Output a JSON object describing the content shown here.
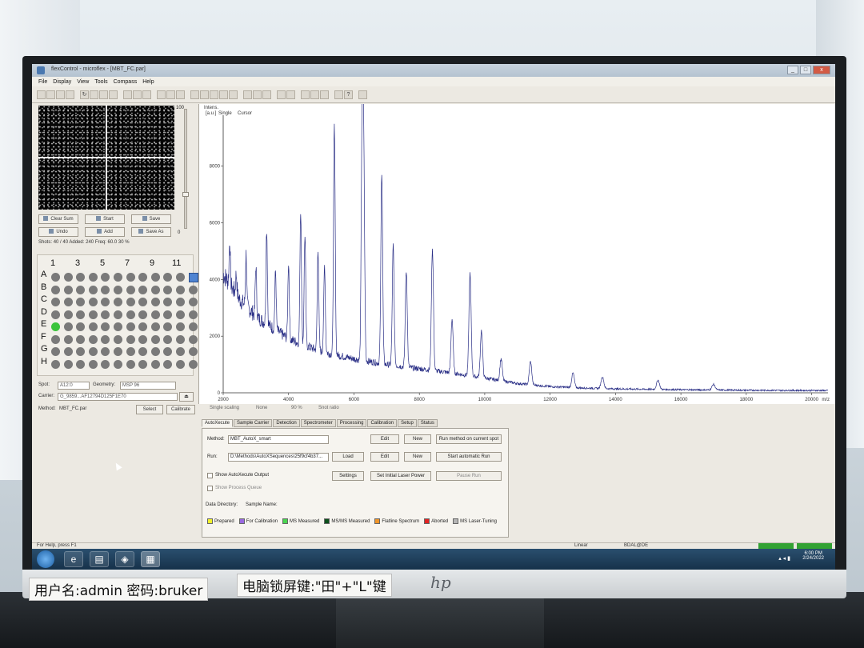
{
  "window": {
    "title": "flexControl - microflex - [MBT_FC.par]"
  },
  "menu": [
    "File",
    "Display",
    "View",
    "Tools",
    "Compass",
    "Help"
  ],
  "camera_panel": {
    "slider_max": "100",
    "slider_min": "0",
    "buttons": {
      "clear_sum": "Clear Sum",
      "start": "Start",
      "save": "Save",
      "undo": "Undo",
      "add": "Add",
      "save_as": "Save As"
    },
    "shots_label": "Shots:",
    "shots_value": "40",
    "shots_total": "40",
    "added_label": "Added:",
    "added_value": "240",
    "freq_label": "Freq:",
    "freq_value": "60.0",
    "percent": "30 %"
  },
  "plate": {
    "columns": [
      "1",
      "3",
      "5",
      "7",
      "9",
      "11"
    ],
    "rows": [
      "A",
      "B",
      "C",
      "D",
      "E",
      "F",
      "G",
      "H"
    ],
    "active_well": "E1"
  },
  "spot_info": {
    "spot_label": "Spot:",
    "spot_value": "A12:0",
    "geometry_label": "Geometry:",
    "geometry_value": "MSP 96",
    "carrier_label": "Carrier:",
    "carrier_value": "G_9859...AF12794D125F1E70",
    "method_label": "Method:",
    "method_value": "MBT_FC.par",
    "select_btn": "Select",
    "calibrate_btn": "Calibrate"
  },
  "spectrum": {
    "y_label": "Intens.",
    "y_unit": "[a.u.]",
    "header_single": "Single",
    "header_cursor": "Cursor",
    "x_unit": "m/z",
    "x_ticks": [
      "2000",
      "4000",
      "6000",
      "8000",
      "10000",
      "12000",
      "14000",
      "16000",
      "18000",
      "20000"
    ],
    "y_ticks": [
      "0",
      "2000",
      "4000",
      "6000",
      "8000"
    ],
    "scale_options": [
      "Single scaling",
      "None",
      "90 %",
      "Snot ratio"
    ]
  },
  "tabs": [
    "AutoXecute",
    "Sample Carrier",
    "Detection",
    "Spectrometer",
    "Processing",
    "Calibration",
    "Setup",
    "Status"
  ],
  "autoxecute": {
    "method_label": "Method:",
    "method_value": "MBT_AutoX_smart",
    "run_label": "Run:",
    "run_value": "D:\\Methods\\AutoXSequences\\25f9cf4b37...",
    "edit1": "Edit",
    "new1": "New",
    "run_on_spot": "Run method on current spot",
    "load": "Load",
    "edit2": "Edit",
    "new2": "New",
    "start_auto": "Start automatic Run",
    "settings": "Settings",
    "set_laser": "Set Initial Laser Power",
    "pause": "Pause Run",
    "show_output": "Show AutoXecute Output",
    "show_queue": "Show Process Queue",
    "data_dir": "Data Directory:",
    "sample_name": "Sample Name:",
    "legend": [
      {
        "label": "Prepared",
        "color": "#f2f22a"
      },
      {
        "label": "For Calibration",
        "color": "#9a6ae0"
      },
      {
        "label": "MS Measured",
        "color": "#49d64f"
      },
      {
        "label": "MS/MS Measured",
        "color": "#0c4f1b"
      },
      {
        "label": "Flatline Spectrum",
        "color": "#f0952a"
      },
      {
        "label": "Aborted",
        "color": "#e32222"
      },
      {
        "label": "MS Laser-Tuning",
        "color": "#b5b5b5"
      }
    ]
  },
  "status_bar": {
    "help": "For Help, press F1",
    "mode": "Linear",
    "tag": "BDAL@DE"
  },
  "taskbar": {
    "time": "6:00 PM",
    "date": "2/24/2022"
  },
  "stickers": {
    "user": "用户名:admin  密码:bruker",
    "lock": "电脑锁屏键:\"田\"+\"L\"键"
  },
  "brand": "hp",
  "chart_data": {
    "type": "line",
    "x_range": [
      2000,
      20500
    ],
    "y_range": [
      0,
      9800
    ],
    "xlabel": "m/z",
    "ylabel": "Intens. [a.u.]",
    "series": [
      {
        "name": "Single",
        "baseline": [
          [
            2000,
            4200
          ],
          [
            2500,
            3300
          ],
          [
            3000,
            2700
          ],
          [
            3500,
            2300
          ],
          [
            4000,
            1900
          ],
          [
            5000,
            1450
          ],
          [
            6000,
            1200
          ],
          [
            7000,
            1000
          ],
          [
            8000,
            850
          ],
          [
            9000,
            700
          ],
          [
            10000,
            520
          ],
          [
            11000,
            330
          ],
          [
            12000,
            220
          ],
          [
            13000,
            170
          ],
          [
            14000,
            140
          ],
          [
            16000,
            110
          ],
          [
            18000,
            90
          ],
          [
            20500,
            80
          ]
        ],
        "peaks": [
          [
            2200,
            5400
          ],
          [
            2400,
            4200
          ],
          [
            2700,
            4900
          ],
          [
            3000,
            4500
          ],
          [
            3330,
            5800
          ],
          [
            3600,
            4300
          ],
          [
            4000,
            4600
          ],
          [
            4370,
            6400
          ],
          [
            4500,
            5600
          ],
          [
            4900,
            5100
          ],
          [
            5100,
            4500
          ],
          [
            5400,
            9400
          ],
          [
            6250,
            9800
          ],
          [
            6300,
            8000
          ],
          [
            6850,
            7800
          ],
          [
            7200,
            5200
          ],
          [
            7600,
            4300
          ],
          [
            8400,
            5100
          ],
          [
            9000,
            2600
          ],
          [
            9550,
            4200
          ],
          [
            9900,
            2200
          ],
          [
            10500,
            1200
          ],
          [
            11400,
            1100
          ],
          [
            12700,
            700
          ],
          [
            13600,
            560
          ],
          [
            15300,
            450
          ],
          [
            17000,
            300
          ]
        ]
      }
    ]
  }
}
